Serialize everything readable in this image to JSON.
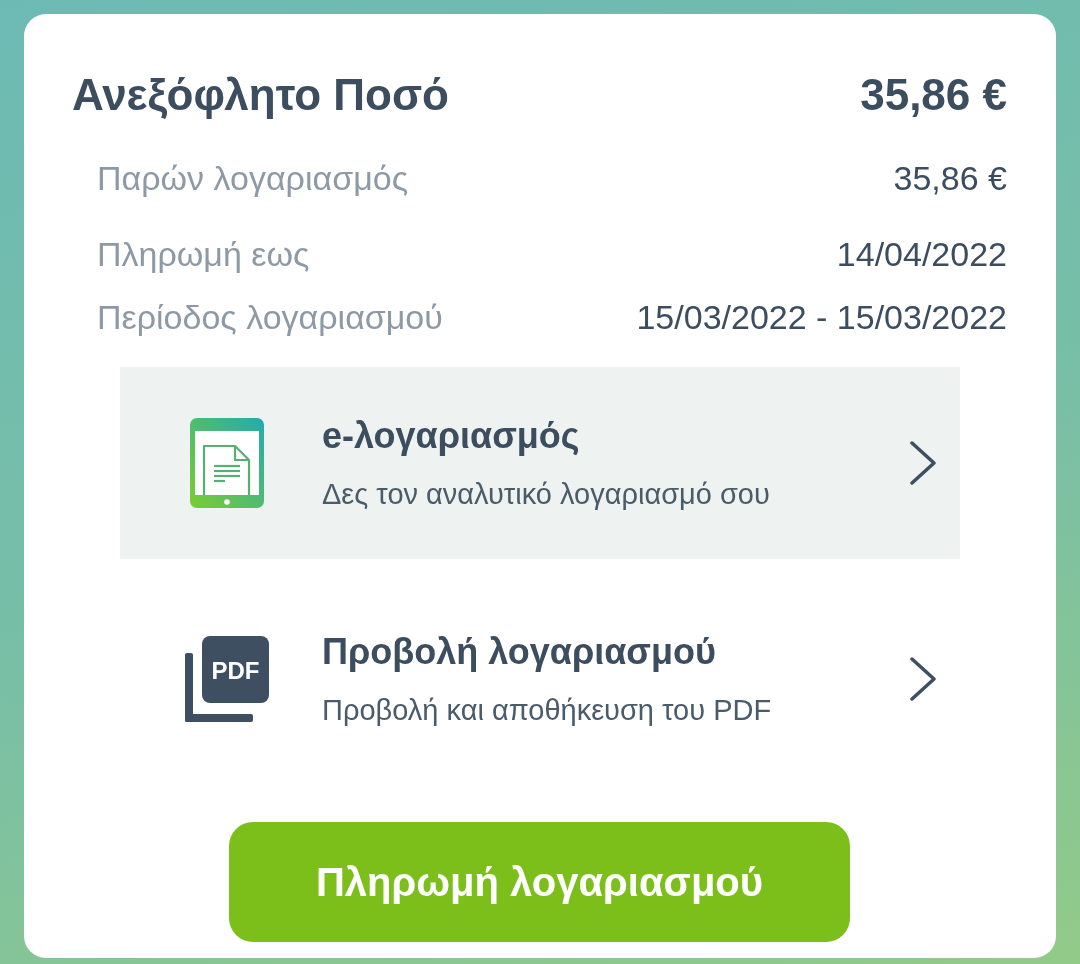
{
  "summary": {
    "title": "Ανεξόφλητο Ποσό",
    "amount": "35,86 €"
  },
  "details": [
    {
      "label": "Παρών λογαριασμός",
      "value": "35,86 €"
    },
    {
      "label": "Πληρωμή εως",
      "value": "14/04/2022"
    },
    {
      "label": "Περίοδος λογαριασμού",
      "value": "15/03/2022 - 15/03/2022"
    }
  ],
  "options": [
    {
      "kind": "tablet",
      "title": "e-λογαριασμός",
      "subtitle": "Δες τον αναλυτικό λογαριασμό σου",
      "selected": true
    },
    {
      "kind": "pdf",
      "icon_text": "PDF",
      "title": "Προβολή λογαριασμού",
      "subtitle": "Προβολή και αποθήκευση του PDF",
      "selected": false
    }
  ],
  "pay_button": {
    "label": "Πληρωμή λογαριασμού"
  }
}
